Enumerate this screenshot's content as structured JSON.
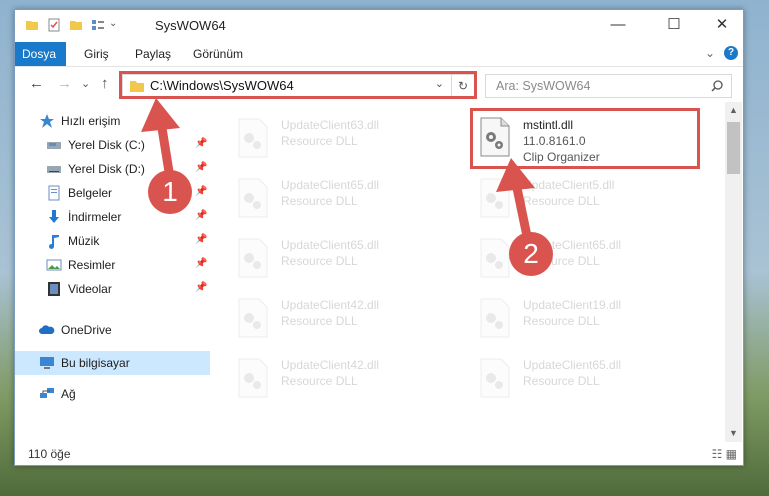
{
  "window": {
    "title": "SysWOW64",
    "minimize": "—",
    "maximize": "☐",
    "close": "✕"
  },
  "ribbon": {
    "tabs": [
      "Dosya",
      "Giriş",
      "Paylaş",
      "Görünüm"
    ],
    "expand": "⌄",
    "help": "?"
  },
  "nav": {
    "back": "←",
    "forward": "→",
    "recent": "⌄",
    "up": "↑"
  },
  "address": {
    "path": "C:\\Windows\\SysWOW64",
    "dropdown": "⌄",
    "refresh": "↻"
  },
  "search": {
    "placeholder": "Ara: SysWOW64",
    "icon": "search-icon"
  },
  "sidebar": {
    "items": [
      {
        "label": "Hızlı erişim",
        "icon": "star-icon",
        "pinned": false
      },
      {
        "label": "Yerel Disk (C:)",
        "icon": "drive-icon",
        "pinned": true
      },
      {
        "label": "Yerel Disk (D:)",
        "icon": "drive-icon",
        "pinned": true
      },
      {
        "label": "Belgeler",
        "icon": "documents-icon",
        "pinned": true
      },
      {
        "label": "İndirmeler",
        "icon": "download-icon",
        "pinned": true
      },
      {
        "label": "Müzik",
        "icon": "music-icon",
        "pinned": true
      },
      {
        "label": "Resimler",
        "icon": "pictures-icon",
        "pinned": true
      },
      {
        "label": "Videolar",
        "icon": "videos-icon",
        "pinned": true
      },
      {
        "label": "OneDrive",
        "icon": "cloud-icon",
        "pinned": false
      },
      {
        "label": "Bu bilgisayar",
        "icon": "computer-icon",
        "pinned": false
      },
      {
        "label": "Ağ",
        "icon": "network-icon",
        "pinned": false
      }
    ]
  },
  "files": {
    "left": [
      {
        "name": "UpdateClient63.dll",
        "type": "Resource DLL"
      },
      {
        "name": "UpdateClient65.dll",
        "type": "Resource DLL"
      },
      {
        "name": "UpdateClient65.dll",
        "type": "Resource DLL"
      },
      {
        "name": "UpdateClient42.dll",
        "type": "Resource DLL"
      },
      {
        "name": "UpdateClient42.dll",
        "type": "Resource DLL"
      }
    ],
    "highlighted": {
      "name": "mstintl.dll",
      "version": "11.0.8161.0",
      "description": "Clip Organizer"
    },
    "right": [
      {
        "name": "UpdateClient5.dll",
        "type": "Resource DLL"
      },
      {
        "name": "UpdateClient65.dll",
        "type": "Resource DLL"
      },
      {
        "name": "UpdateClient19.dll",
        "type": "Resource DLL"
      },
      {
        "name": "UpdateClient65.dll",
        "type": "Resource DLL"
      }
    ]
  },
  "status": {
    "count": "110 öğe"
  },
  "markers": [
    "1",
    "2"
  ],
  "colors": {
    "accent": "#1979ca",
    "highlight": "#d9534f",
    "selection": "#cce8ff"
  }
}
